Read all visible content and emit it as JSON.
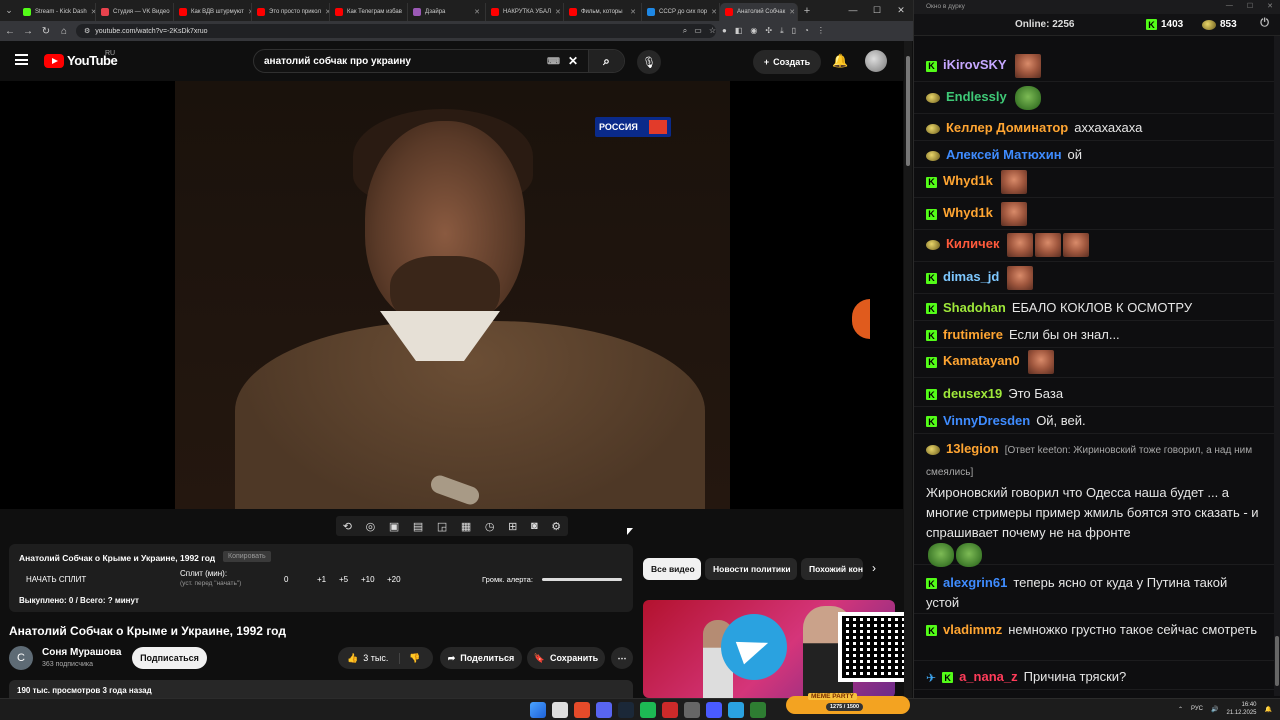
{
  "tabs": [
    {
      "label": "Stream - Kick Dash",
      "color": "#53fc18",
      "active": false
    },
    {
      "label": "Студия — VK Видео",
      "color": "#e8424d",
      "active": false
    },
    {
      "label": "Как ВДВ штурмуют",
      "color": "#ff0000",
      "active": false
    },
    {
      "label": "Это просто прикол",
      "color": "#ff0000",
      "active": false
    },
    {
      "label": "Как Телеграм избав",
      "color": "#ff0000",
      "active": false
    },
    {
      "label": "Дзайра",
      "color": "#9b59b6",
      "active": false
    },
    {
      "label": "НАКРУТКА УБАЛ",
      "color": "#ff0000",
      "active": false
    },
    {
      "label": "Фильм, которы",
      "color": "#ff0000",
      "active": false
    },
    {
      "label": "СССР до сих пор",
      "color": "#1e88e5",
      "active": false
    },
    {
      "label": "Анатолий Собчак",
      "color": "#ff0000",
      "active": true
    }
  ],
  "address": {
    "url": "youtube.com/watch?v=-2KsDk7xruo"
  },
  "header": {
    "logo_text": "YouTube",
    "region": "RU",
    "search_value": "анатолий собчак про украину",
    "create_label": "Создать"
  },
  "player": {
    "channel_logo_text": "РОССИЯ"
  },
  "plugin": {
    "title": "Анатолий Собчак о Крыме и Украине, 1992 год",
    "copy_label": "Копировать",
    "split_label": "НАЧАТЬ СПЛИТ",
    "split_min_label": "Сплит (мин):",
    "split_hint": "(уст. перед \"начать\")",
    "split_value": "0",
    "step_buttons": [
      "+1",
      "+5",
      "+10",
      "+20"
    ],
    "volume_label": "Громк. алерта:",
    "volume_level": 1.0,
    "bought": "Выкуплено: 0 / Всего: ? минут"
  },
  "video": {
    "title": "Анатолий Собчак о Крыме и Украине, 1992 год",
    "channel_initial": "С",
    "channel_name": "Соня Мурашова",
    "subscribers": "363 подписчика",
    "subscribe_label": "Подписаться",
    "likes": "3 тыс.",
    "share_label": "Поделиться",
    "save_label": "Сохранить",
    "description": "190 тыс. просмотров  3 года назад"
  },
  "chips": [
    "Все видео",
    "Новости политики",
    "Похожий контент"
  ],
  "chat": {
    "window_title": "Окно в дурку",
    "online_label": "Online:",
    "online_count": "2256",
    "kick_count": "1403",
    "gold_count": "853",
    "messages": [
      {
        "badges": [
          "kick"
        ],
        "user": "iKirovSKY",
        "color": "#c6a7ff",
        "text": "",
        "emotes": [
          "face"
        ]
      },
      {
        "badges": [
          "gold"
        ],
        "user": "Endlessly",
        "color": "#3fc977",
        "text": "",
        "emotes": [
          "frog"
        ]
      },
      {
        "badges": [
          "gold"
        ],
        "user": "Келлер Доминатор",
        "color": "#ffa532",
        "text": "аххахахаха",
        "emotes": []
      },
      {
        "badges": [
          "gold"
        ],
        "user": "Алексей Матюхин",
        "color": "#3f8cff",
        "text": "ой",
        "emotes": []
      },
      {
        "badges": [
          "kick"
        ],
        "user": "Whyd1k",
        "color": "#ffa532",
        "text": "",
        "emotes": [
          "face"
        ]
      },
      {
        "badges": [
          "kick"
        ],
        "user": "Whyd1k",
        "color": "#ffa532",
        "text": "",
        "emotes": [
          "face"
        ]
      },
      {
        "badges": [
          "gold"
        ],
        "user": "Киличек",
        "color": "#ff5a3c",
        "text": "",
        "emotes": [
          "face",
          "face",
          "face"
        ]
      },
      {
        "badges": [
          "kick"
        ],
        "user": "dimas_jd",
        "color": "#7ec8ff",
        "text": "",
        "emotes": [
          "face"
        ]
      },
      {
        "badges": [
          "kick"
        ],
        "user": "Shadohan",
        "color": "#9fe83a",
        "text": "ЕБАЛО КОКЛОВ К ОСМОТРУ",
        "emotes": []
      },
      {
        "badges": [
          "kick"
        ],
        "user": "frutimiere",
        "color": "#ffa532",
        "text": "Если бы он знал...",
        "emotes": []
      },
      {
        "badges": [
          "kick"
        ],
        "user": "Kamatayan0",
        "color": "#ffa532",
        "text": "",
        "emotes": [
          "face"
        ]
      },
      {
        "badges": [
          "kick"
        ],
        "user": "deusex19",
        "color": "#9fe83a",
        "text": "Это База",
        "emotes": []
      },
      {
        "badges": [
          "kick"
        ],
        "user": "VinnyDresden",
        "color": "#3f8cff",
        "text": "Ой, вей.",
        "emotes": []
      },
      {
        "badges": [
          "gold"
        ],
        "user": "13legion",
        "color": "#ffa532",
        "reply": "[Ответ keeton: Жириновский тоже говорил, а над ним смеялись]",
        "text": "Жироновский говорил что  Одесса наша будет ... а многие стримеры пример жмиль боятся это сказать - и спрашивает почему не на фронте",
        "emotes": [
          "frog",
          "frog"
        ]
      },
      {
        "badges": [
          "kick"
        ],
        "user": "alexgrin61",
        "color": "#3f8cff",
        "text": "теперь ясно от куда у Путина такой устой",
        "emotes": []
      },
      {
        "badges": [
          "kick"
        ],
        "user": "vladimmz",
        "color": "#ffa532",
        "text": "немножко грустно такое сейчас смотреть",
        "emotes": []
      },
      {
        "badges": [
          "sword",
          "kick"
        ],
        "user": "a_nana_z",
        "color": "#ff3c5a",
        "text": "Причина тряски?",
        "emotes": []
      }
    ]
  },
  "taskbar": {
    "meme_label": "MEME PARTY",
    "meme_counter": "1275 / 1500",
    "lang": "РУС",
    "time": "16:40",
    "date": "21.12.2025"
  }
}
